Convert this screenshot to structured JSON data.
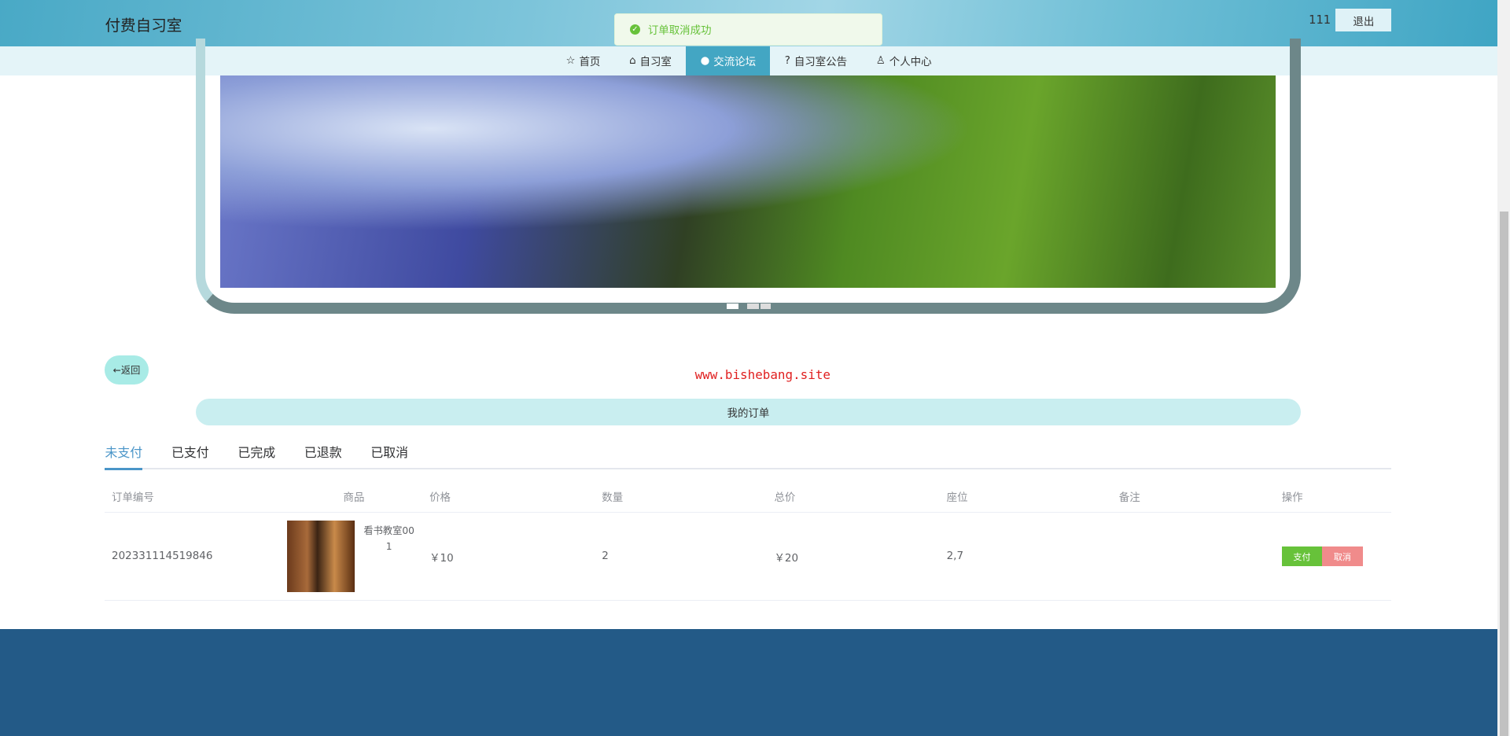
{
  "header": {
    "site_title": "付费自习室",
    "user": "111",
    "logout": "退出"
  },
  "nav": [
    {
      "label": "首页",
      "icon": "☆"
    },
    {
      "label": "自习室",
      "icon": "⌂"
    },
    {
      "label": "交流论坛",
      "icon": "●",
      "active": true
    },
    {
      "label": "自习室公告",
      "icon": "?"
    },
    {
      "label": "个人中心",
      "icon": "♙"
    }
  ],
  "toast": {
    "message": "订单取消成功",
    "icon": "✓"
  },
  "back_label": "←返回",
  "watermark": "www.bishebang.site",
  "banner": "我的订单",
  "tabs": [
    "未支付",
    "已支付",
    "已完成",
    "已退款",
    "已取消"
  ],
  "table": {
    "headers": [
      "订单编号",
      "商品",
      "价格",
      "数量",
      "总价",
      "座位",
      "备注",
      "操作"
    ],
    "rows": [
      {
        "order_no": "202331114519846",
        "product": "看书教室001",
        "price": "￥10",
        "qty": "2",
        "total": "￥20",
        "seat": "2,7",
        "note": "",
        "pay": "支付",
        "cancel": "取消"
      }
    ]
  },
  "colors": {
    "accent": "#43a6c3",
    "footer": "#235a87",
    "pay": "#67c23a",
    "cancel": "#f08b8b"
  }
}
